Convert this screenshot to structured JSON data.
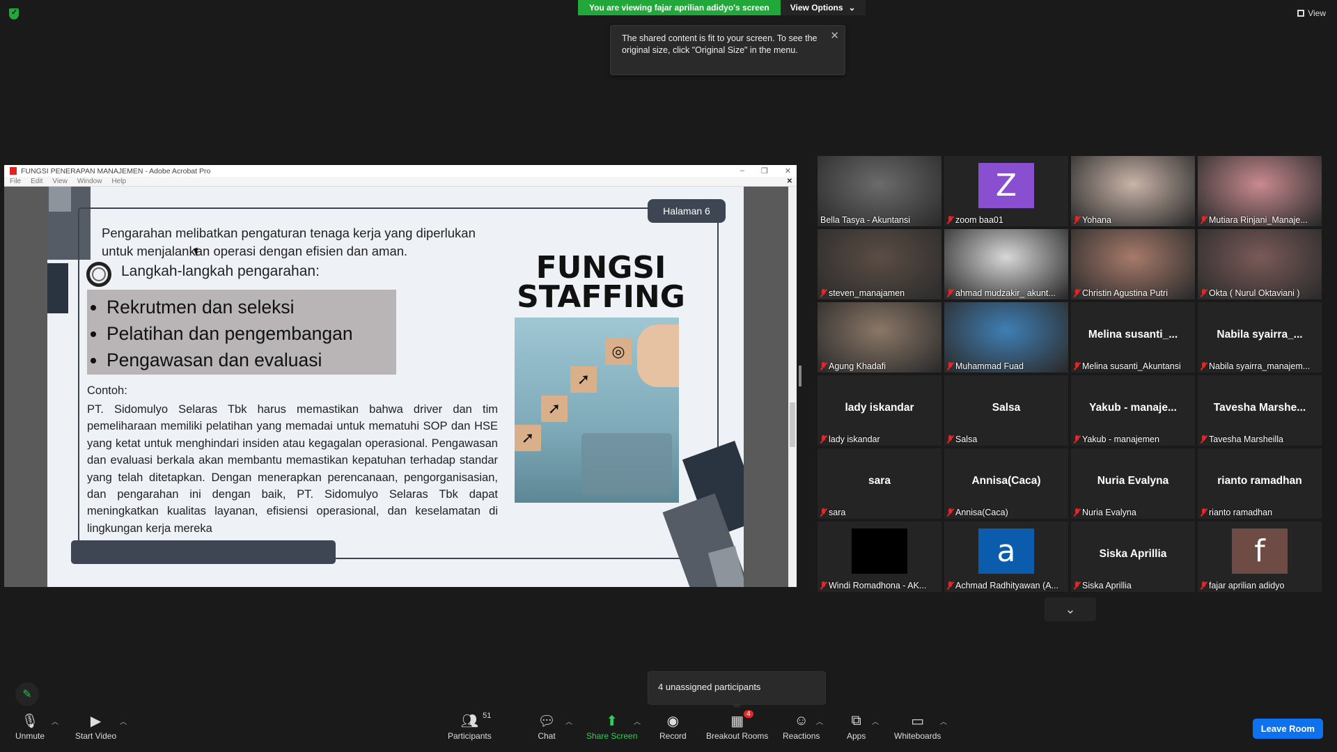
{
  "banner": {
    "viewing": "You are viewing fajar aprilian adidyo's screen",
    "view_options": "View Options"
  },
  "top_right": {
    "view": "View"
  },
  "tooltip": {
    "text": "The shared content is fit to your screen. To see the original size, click \"Original Size\" in the menu."
  },
  "acrobat": {
    "title": "FUNGSI PENERAPAN MANAJEMEN - Adobe Acrobat Pro",
    "menu": [
      "File",
      "Edit",
      "View",
      "Window",
      "Help"
    ]
  },
  "slide": {
    "page_badge": "Halaman 6",
    "intro": "Pengarahan melibatkan pengaturan tenaga kerja yang diperlukan untuk menjalankan operasi dengan efisien dan aman.",
    "steps_heading": "Langkah-langkah pengarahan:",
    "steps": [
      "Rekrutmen dan seleksi",
      "Pelatihan dan pengembangan",
      "Pengawasan dan evaluasi"
    ],
    "contoh_label": "Contoh:",
    "contoh_text": "PT. Sidomulyo Selaras Tbk harus memastikan bahwa driver dan tim pemeliharaan memiliki pelatihan yang memadai untuk mematuhi SOP dan HSE yang ketat untuk menghindari insiden atau kegagalan operasional. Pengawasan dan evaluasi berkala akan membantu memastikan kepatuhan terhadap standar yang telah ditetapkan. Dengan menerapkan perencanaan, pengorganisasian, dan pengarahan ini dengan baik, PT. Sidomulyo Selaras Tbk dapat meningkatkan kualitas layanan, efisiensi operasional, dan keselamatan di lingkungan kerja mereka",
    "title_line1": "FUNGSI",
    "title_line2": "STAFFING"
  },
  "participants": [
    {
      "label": "Bella Tasya - Akuntansi",
      "type": "video",
      "active": true,
      "muted": false,
      "color": "#6b6b6b"
    },
    {
      "label": "zoom baa01",
      "type": "letter",
      "letter": "Z",
      "color": "#8a4fd0",
      "muted": true
    },
    {
      "label": "Yohana",
      "type": "video",
      "color": "#c9b4a8",
      "muted": true
    },
    {
      "label": "Mutiara Rinjani_Manaje...",
      "type": "video",
      "color": "#c98a8f",
      "muted": true
    },
    {
      "label": "steven_manajamen",
      "type": "video",
      "color": "#5b4d44",
      "muted": true
    },
    {
      "label": "ahmad mudzakir_ akunt...",
      "type": "video",
      "color": "#d8d8d8",
      "muted": true
    },
    {
      "label": "Christin Agustina Putri",
      "type": "video",
      "color": "#a77a6a",
      "muted": true
    },
    {
      "label": "Okta ( Nurul Oktaviani )",
      "type": "video",
      "color": "#7a5a58",
      "muted": true
    },
    {
      "label": "Agung Khadafi",
      "type": "video",
      "color": "#8b7767",
      "muted": true
    },
    {
      "label": "Muhammad Fuad",
      "type": "video",
      "color": "#3f7fb5",
      "muted": true
    },
    {
      "label": "Melina susanti_Akuntansi",
      "type": "name",
      "bigname": "Melina  susanti_...",
      "muted": true
    },
    {
      "label": "Nabila syairra_manajem...",
      "type": "name",
      "bigname": "Nabila  syairra_...",
      "muted": true
    },
    {
      "label": "lady iskandar",
      "type": "name",
      "bigname": "lady iskandar",
      "muted": true
    },
    {
      "label": "Salsa",
      "type": "name",
      "bigname": "Salsa",
      "muted": true
    },
    {
      "label": "Yakub - manajemen",
      "type": "name",
      "bigname": "Yakub  - manaje...",
      "muted": true
    },
    {
      "label": "Tavesha Marsheilla",
      "type": "name",
      "bigname": "Tavesha  Marshe...",
      "muted": true
    },
    {
      "label": "sara",
      "type": "name",
      "bigname": "sara",
      "muted": true
    },
    {
      "label": "Annisa(Caca)",
      "type": "name",
      "bigname": "Annisa(Caca)",
      "muted": true
    },
    {
      "label": "Nuria Evalyna",
      "type": "name",
      "bigname": "Nuria Evalyna",
      "muted": true
    },
    {
      "label": "rianto ramadhan",
      "type": "name",
      "bigname": "rianto ramadhan",
      "muted": true
    },
    {
      "label": "Windi Romadhona - AK...",
      "type": "black",
      "muted": true
    },
    {
      "label": "Achmad Radhityawan (A...",
      "type": "letter",
      "letter": "a",
      "color": "#0b5cad",
      "muted": true
    },
    {
      "label": "Siska Aprillia",
      "type": "name",
      "bigname": "Siska Aprillia",
      "muted": true
    },
    {
      "label": "fajar aprilian adidyo",
      "type": "letter",
      "letter": "f",
      "color": "#6e4b44",
      "muted": true
    }
  ],
  "unassigned": "4 unassigned participants",
  "toolbar": {
    "unmute": "Unmute",
    "start_video": "Start Video",
    "participants": "Participants",
    "participants_count": "51",
    "chat": "Chat",
    "share_screen": "Share Screen",
    "record": "Record",
    "breakout_rooms": "Breakout Rooms",
    "breakout_badge": "4",
    "reactions": "Reactions",
    "apps": "Apps",
    "whiteboards": "Whiteboards",
    "leave": "Leave Room"
  }
}
